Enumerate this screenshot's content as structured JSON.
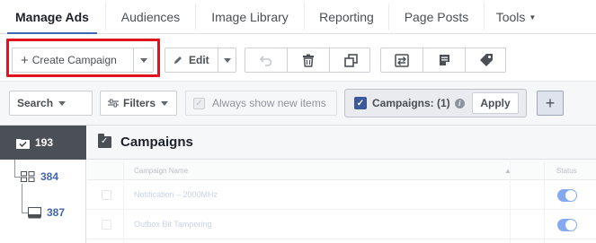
{
  "nav": {
    "tabs": [
      {
        "label": "Manage Ads"
      },
      {
        "label": "Audiences"
      },
      {
        "label": "Image Library"
      },
      {
        "label": "Reporting"
      },
      {
        "label": "Page Posts"
      },
      {
        "label": "Tools"
      }
    ]
  },
  "toolbar": {
    "create_label": "Create Campaign",
    "edit_label": "Edit",
    "icons": [
      "undo-icon",
      "trash-icon",
      "duplicate-icon",
      "export-import-icon",
      "notes-icon",
      "tag-icon"
    ]
  },
  "filters": {
    "search_label": "Search",
    "filters_label": "Filters",
    "always_show_label": "Always show new items",
    "campaigns_filter_label": "Campaigns: (1)",
    "apply_label": "Apply"
  },
  "rail": {
    "active_count": "193",
    "items": [
      {
        "count": "384",
        "icon": "adsets-icon"
      },
      {
        "count": "387",
        "icon": "ad-icon"
      }
    ]
  },
  "main": {
    "title": "Campaigns",
    "columns": [
      "Campaign Name",
      "Status"
    ],
    "rows": [
      {
        "name": "Notification – 2000MHz",
        "status_on": true
      },
      {
        "name": "Outbox Bit Tampering",
        "status_on": true
      }
    ]
  },
  "colors": {
    "accent": "#4267b2",
    "highlight_box": "#e0141e",
    "rail_active": "#4b4f56"
  }
}
